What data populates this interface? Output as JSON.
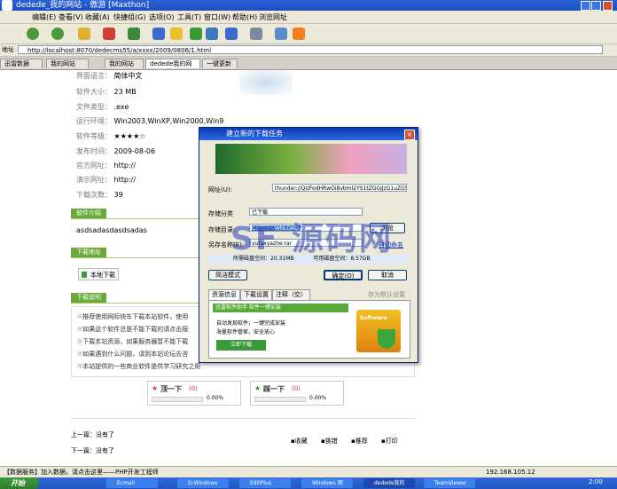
{
  "window": {
    "title": "dedede_我的网站 - 傲游 [Maxthon]"
  },
  "menu": [
    "编辑(E)",
    "查看(V)",
    "收藏(A)",
    "快捷组(G)",
    "选项(O)",
    "工具(T)",
    "窗口(W)",
    "帮助(H)",
    "浏览网址"
  ],
  "address": {
    "label": "地址",
    "url": "http://localhost:8070/dedecms55/a/xxxx/2009/0806/1.html"
  },
  "tabs": [
    "迅雷数据(宝)",
    "我的网站",
    "我的网站",
    "dedede我的网站",
    "一键更新"
  ],
  "software_info": [
    {
      "key": "界面语言：",
      "value": "简体中文"
    },
    {
      "key": "软件大小：",
      "value": "23 MB"
    },
    {
      "key": "文件类型：",
      "value": ".exe"
    },
    {
      "key": "运行环境：",
      "value": "Win2003,WinXP,Win2000,Win9"
    },
    {
      "key": "软件等级：",
      "value": "★★★★☆"
    },
    {
      "key": "发布时间：",
      "value": "2009-08-06"
    },
    {
      "key": "官方网址：",
      "value": "http://"
    },
    {
      "key": "演示网址：",
      "value": "http://"
    },
    {
      "key": "下载次数：",
      "value": "39"
    }
  ],
  "sections": {
    "intro": "软件介绍",
    "download": "下载地址",
    "notes": "下载说明"
  },
  "intro_text": "asdsadasdasdsadas",
  "download_button": "本地下载",
  "notes_lines": [
    "☉推荐使用网际快车下载本站软件，使用",
    "☉如果这个软件总是不能下载的请点击报",
    "☉下载本站资源，如果服务器暂不能下载",
    "☉如果遇到什么问题，请到本站论坛去咨",
    "☉本站提供的一些商业软件是供学习研究之用"
  ],
  "vote": {
    "up_label": "顶一下",
    "up_count": "(0)",
    "up_pct": "0.00%",
    "down_label": "踩一下",
    "down_count": "(0)",
    "down_pct": "0.00%"
  },
  "nav": {
    "prev": "上一篇：没有了",
    "next": "下一篇：没有了"
  },
  "actions": [
    "收藏",
    "挑错",
    "推荐",
    "打印"
  ],
  "dialog": {
    "title": "建立新的下载任务",
    "url_label": "网址(U):",
    "url_value": "thunder://QUFodHRwOi8vbmI2YS1tZGGjJzG1uZG5jb20vMjAwOS8wN",
    "category_label": "存储分类",
    "category_value": "已下载",
    "dir_label": "存储目录:",
    "dir_value": "C:\\TDDOWNLOAD\\",
    "browse_btn": "浏览",
    "save_as_label": "另存名称(E):",
    "save_as_value": "yufaxyazhe.rar",
    "auto_rename": "自动命名",
    "disk_info_label": "所需磁盘空间：",
    "disk_info_value": "20.31MB",
    "free_label": "可用磁盘空间：",
    "free_value": "8.57GB",
    "simple_mode": "简洁模式",
    "ok": "确定(O)",
    "cancel": "取消",
    "tabs": [
      "资源信息",
      "下载设置",
      "注释（空）"
    ],
    "set_default": "存为默认设置",
    "ad_title": "迅雷软件助手 软件一键安装",
    "ad_lines": [
      "自动发现软件，一键完成安装",
      "海量软件管家，安全放心"
    ],
    "ad_btn": "立即下载",
    "ad_logo": "Software"
  },
  "watermark": "SF 源码网",
  "status": {
    "left": "【数据服务】加入数据，请点击这里——PHP开发工程师",
    "ip": "192.168.105.12",
    "clock": "2:00"
  },
  "taskbar": {
    "start": "开始",
    "tasks": [
      "Ecmail",
      "D:Windows",
      "EditPlus",
      "Windows 网",
      "dedede我的",
      "TeamViewer"
    ]
  },
  "colors": {
    "accent": "#6aa93a",
    "titlebar": "#2a62d8",
    "taskbar": "#3168d5"
  }
}
